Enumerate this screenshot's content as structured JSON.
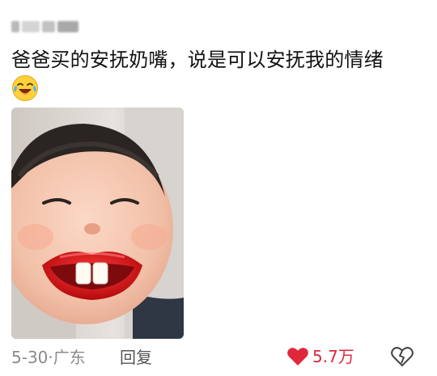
{
  "post": {
    "text": "爸爸买的安抚奶嘴，说是可以安抚我的情绪",
    "emoji": "laughing-crying-emoji",
    "image_alt": "photo of a toddler with a red lips pacifier"
  },
  "footer": {
    "meta": "5-30·广东",
    "reply_label": "回复",
    "like_count": "5.7万"
  },
  "colors": {
    "like": "#e0283c",
    "meta": "#8a8a8a",
    "text": "#111111"
  },
  "icons": {
    "like": "heart-icon",
    "dislike": "broken-heart-icon"
  }
}
